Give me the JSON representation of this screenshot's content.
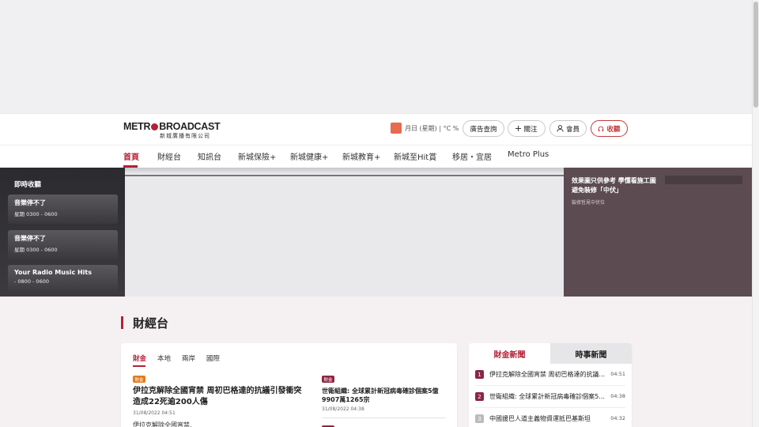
{
  "header": {
    "logo_text_left": "METR",
    "logo_text_right": "BROADCAST",
    "logo_subtitle": "新城廣播有限公司",
    "weather_text": "月日 (星期) | °C %",
    "ad_lookup_label": "廣告查詢",
    "follow_label": "關注",
    "member_label": "會員",
    "listen_label": "收聽"
  },
  "nav": {
    "items": [
      "首頁",
      "財經台",
      "知訊台",
      "新城保險+",
      "新城健康+",
      "新城教育+",
      "新城至Hit賞",
      "移居・宜居",
      "Metro Plus"
    ]
  },
  "radio": {
    "title": "即時收聽",
    "programs": [
      {
        "title": "音樂停不了",
        "time": "星期 0300 - 0600"
      },
      {
        "title": "音樂停不了",
        "time": "星期 0300 - 0600"
      },
      {
        "title": "Your Radio Music Hits",
        "time": "- 0800 - 0600"
      }
    ]
  },
  "hero": {
    "headline": "效果圖只供參考 學懂看施工圖避免裝修「中伏」",
    "source": "裝修哲見中伏位"
  },
  "section": {
    "title": "財經台",
    "tabs": [
      "財金",
      "本地",
      "兩岸",
      "國際"
    ],
    "tag_label": "財金",
    "main_story": {
      "title": "伊拉克解除全國宵禁 周初巴格達的抗議引發衝突造成22死逾200人傷",
      "date": "31/08/2022 04:51",
      "excerpt": "伊拉克解除全國宵禁,"
    },
    "second_story": {
      "title": "世衛組織: 全球累計新冠病毒確診個案5億9907萬1265宗",
      "date": "31/08/2022 04:38"
    }
  },
  "sidebar": {
    "tab_active": "財金新聞",
    "tab_inactive": "時事新聞",
    "items": [
      {
        "rank": "1",
        "text": "伊拉克解除全國宵禁 周初巴格達的抗議...",
        "time": "04:51"
      },
      {
        "rank": "2",
        "text": "世衛組織: 全球累計新冠病毒確診個案5...",
        "time": "04:38"
      },
      {
        "rank": "3",
        "text": "中國援巴人道主義物資運抵巴基斯坦",
        "time": "04:32"
      }
    ]
  },
  "colors": {
    "accent": "#b32134",
    "tag_orange": "#e07a1d",
    "tag_maroon": "#8c2643"
  }
}
